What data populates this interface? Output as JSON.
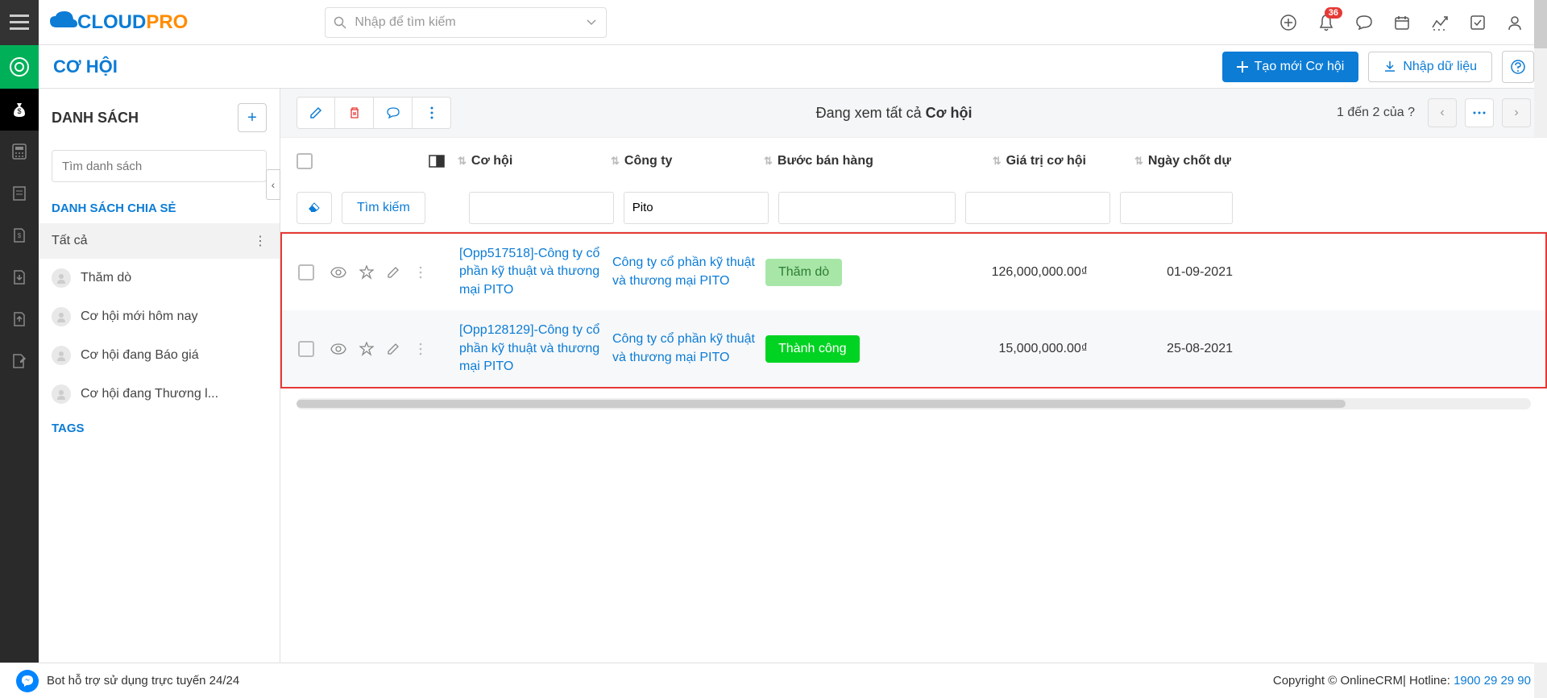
{
  "header": {
    "search_placeholder": "Nhập để tìm kiếm",
    "notification_count": "36"
  },
  "module": {
    "title": "CƠ HỘI",
    "create_label": "Tạo mới Cơ hội",
    "import_label": "Nhập dữ liệu"
  },
  "sidebar": {
    "list_title": "DANH SÁCH",
    "search_placeholder": "Tìm danh sách",
    "shared_title": "DANH SÁCH CHIA SẺ",
    "items": [
      {
        "label": "Tất cả",
        "selected": true
      },
      {
        "label": "Thăm dò"
      },
      {
        "label": "Cơ hội mới hôm nay"
      },
      {
        "label": "Cơ hội đang Báo giá"
      },
      {
        "label": "Cơ hội đang Thương l..."
      }
    ],
    "tags_title": "TAGS"
  },
  "toolbar": {
    "viewing_prefix": "Đang xem tất cả ",
    "viewing_bold": "Cơ hội",
    "pagination_text": "1 đến 2 của  ?"
  },
  "table": {
    "columns": {
      "opportunity": "Cơ hội",
      "company": "Công ty",
      "stage": "Bước bán hàng",
      "value": "Giá trị cơ hội",
      "close_date": "Ngày chốt dự"
    },
    "filter": {
      "search_label": "Tìm kiếm",
      "company_value": "Pito"
    },
    "rows": [
      {
        "opportunity": "[Opp517518]-Công ty cổ phần kỹ thuật và thương mại PITO",
        "company": "Công ty cổ phần kỹ thuật và thương mại PITO",
        "stage": "Thăm dò",
        "stage_class": "status-tham",
        "value": "126,000,000.00₫",
        "close_date": "01-09-2021"
      },
      {
        "opportunity": "[Opp128129]-Công ty cổ phần kỹ thuật và thương mại PITO",
        "company": "Công ty cổ phần kỹ thuật và thương mại PITO",
        "stage": "Thành công",
        "stage_class": "status-thanh",
        "value": "15,000,000.00₫",
        "close_date": "25-08-2021"
      }
    ]
  },
  "footer": {
    "bot_text": "Bot hỗ trợ sử dụng trực tuyến 24/24",
    "copyright_text": "Copyright © OnlineCRM| Hotline: ",
    "hotline": "1900 29 29 90"
  },
  "logo": {
    "cloud": "CLOUD",
    "pro": "PRO"
  }
}
